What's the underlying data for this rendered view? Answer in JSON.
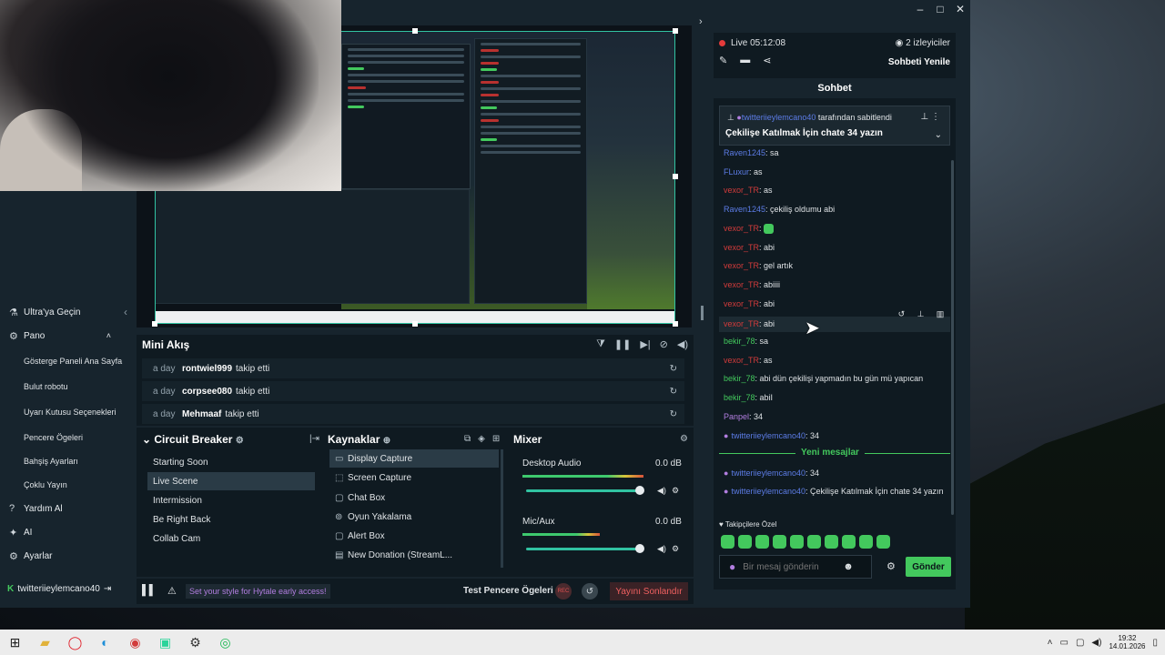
{
  "window_controls": [
    "–",
    "□",
    "✕"
  ],
  "left_nav": {
    "items": [
      {
        "icon": "rocket-icon",
        "label": "Ultra'ya Geçin"
      },
      {
        "icon": "dashboard-icon",
        "label": "Pano"
      }
    ],
    "subitems": [
      "Gösterge Paneli Ana Sayfa",
      "Bulut robotu",
      "Uyarı Kutusu Seçenekleri",
      "Pencere Ögeleri",
      "Bahşiş Ayarları",
      "Çoklu Yayın"
    ],
    "bottom_items": [
      {
        "icon": "help-icon",
        "label": "Yardım Al"
      },
      {
        "icon": "ai-icon",
        "label": "AI"
      },
      {
        "icon": "settings-icon",
        "label": "Ayarlar"
      }
    ],
    "user": "twitteriieylemcano40"
  },
  "mini_feed": {
    "title": "Mini Akış",
    "rows": [
      {
        "time": "a day",
        "name": "rontwiel999",
        "action": "takip etti"
      },
      {
        "time": "a day",
        "name": "corpsee080",
        "action": "takip etti"
      },
      {
        "time": "a day",
        "name": "Mehmaaf",
        "action": "takip etti"
      }
    ]
  },
  "scenes": {
    "title": "Circuit Breaker",
    "items": [
      "Starting Soon",
      "Live Scene",
      "Intermission",
      "Be Right Back",
      "Collab Cam"
    ],
    "selected": "Live Scene"
  },
  "sources": {
    "title": "Kaynaklar",
    "items": [
      "Display Capture",
      "Screen Capture",
      "Chat Box",
      "Oyun Yakalama",
      "Alert Box",
      "New Donation (StreamL..."
    ]
  },
  "mixer": {
    "title": "Mixer",
    "channels": [
      {
        "name": "Desktop Audio",
        "db": "0.0 dB",
        "level": 0.78,
        "volume": 0.98
      },
      {
        "name": "Mic/Aux",
        "db": "0.0 dB",
        "level": 0.5,
        "volume": 0.98
      }
    ]
  },
  "status_bar": {
    "promo": "Set your style for Hytale early access!",
    "test_label": "Test Pencere Ögeleri",
    "rec": "REC",
    "end_label": "Yayını Sonlandır"
  },
  "chat": {
    "live_time": "Live 05:12:08",
    "viewers": "2 izleyiciler",
    "refresh": "Sohbeti Yenile",
    "header": "Sohbet",
    "pinned_by": "twitteriieylemcano40",
    "pinned_suffix": " tarafından sabitlendi",
    "pinned_text": "Çekilişe Katılmak İçin chate 34 yazın",
    "messages": [
      {
        "user": "Raven1245",
        "text": ": sa",
        "color": "#5c7ce6"
      },
      {
        "user": "FLuxur",
        "text": ": as",
        "color": "#5c7ce6"
      },
      {
        "user": "vexor_TR",
        "text": ": as",
        "color": "#d23b3b"
      },
      {
        "user": "Raven1245",
        "text": ": çekiliş oldumu abi",
        "color": "#5c7ce6"
      },
      {
        "user": "vexor_TR",
        "text": ": ",
        "color": "#d23b3b",
        "emote": true
      },
      {
        "user": "vexor_TR",
        "text": ": abi",
        "color": "#d23b3b"
      },
      {
        "user": "vexor_TR",
        "text": ": gel artık",
        "color": "#d23b3b"
      },
      {
        "user": "vexor_TR",
        "text": ": abiiii",
        "color": "#d23b3b"
      },
      {
        "user": "vexor_TR",
        "text": ": abi",
        "color": "#d23b3b"
      },
      {
        "user": "vexor_TR",
        "text": ": abi",
        "color": "#d23b3b"
      },
      {
        "user": "bekir_78",
        "text": ": sa",
        "color": "#43c85d"
      },
      {
        "user": "vexor_TR",
        "text": ": as",
        "color": "#d23b3b"
      },
      {
        "user": "bekir_78",
        "text": ": abi dün çekilişi yapmadın bu gün mü yapıcan",
        "color": "#43c85d"
      },
      {
        "user": "bekir_78",
        "text": ": abiI",
        "color": "#43c85d"
      },
      {
        "user": "Panpel",
        "text": ": 34",
        "color": "#b27ee0"
      },
      {
        "user": "twitteriieylemcano40",
        "text": ": 34",
        "color": "#5c7ce6",
        "mic": true
      }
    ],
    "new_messages_label": "Yeni mesajlar",
    "new_messages": [
      {
        "user": "twitteriieylemcano40",
        "text": ": 34",
        "color": "#5c7ce6",
        "mic": true
      },
      {
        "user": "twitteriieylemcano40",
        "text": ": Çekilişe Katılmak İçin chate 34 yazın",
        "color": "#5c7ce6",
        "mic": true
      }
    ],
    "followers_only": "Takipçilere Özel",
    "input_placeholder": "Bir mesaj gönderin",
    "send_label": "Gönder"
  },
  "taskbar": {
    "apps": [
      "windows-icon",
      "file-explorer-icon",
      "opera-icon",
      "edge-icon",
      "chrome-icon",
      "streamlabs-icon",
      "settings-icon",
      "spotify-icon"
    ],
    "time": "19:32",
    "date": "14.01.2026"
  }
}
